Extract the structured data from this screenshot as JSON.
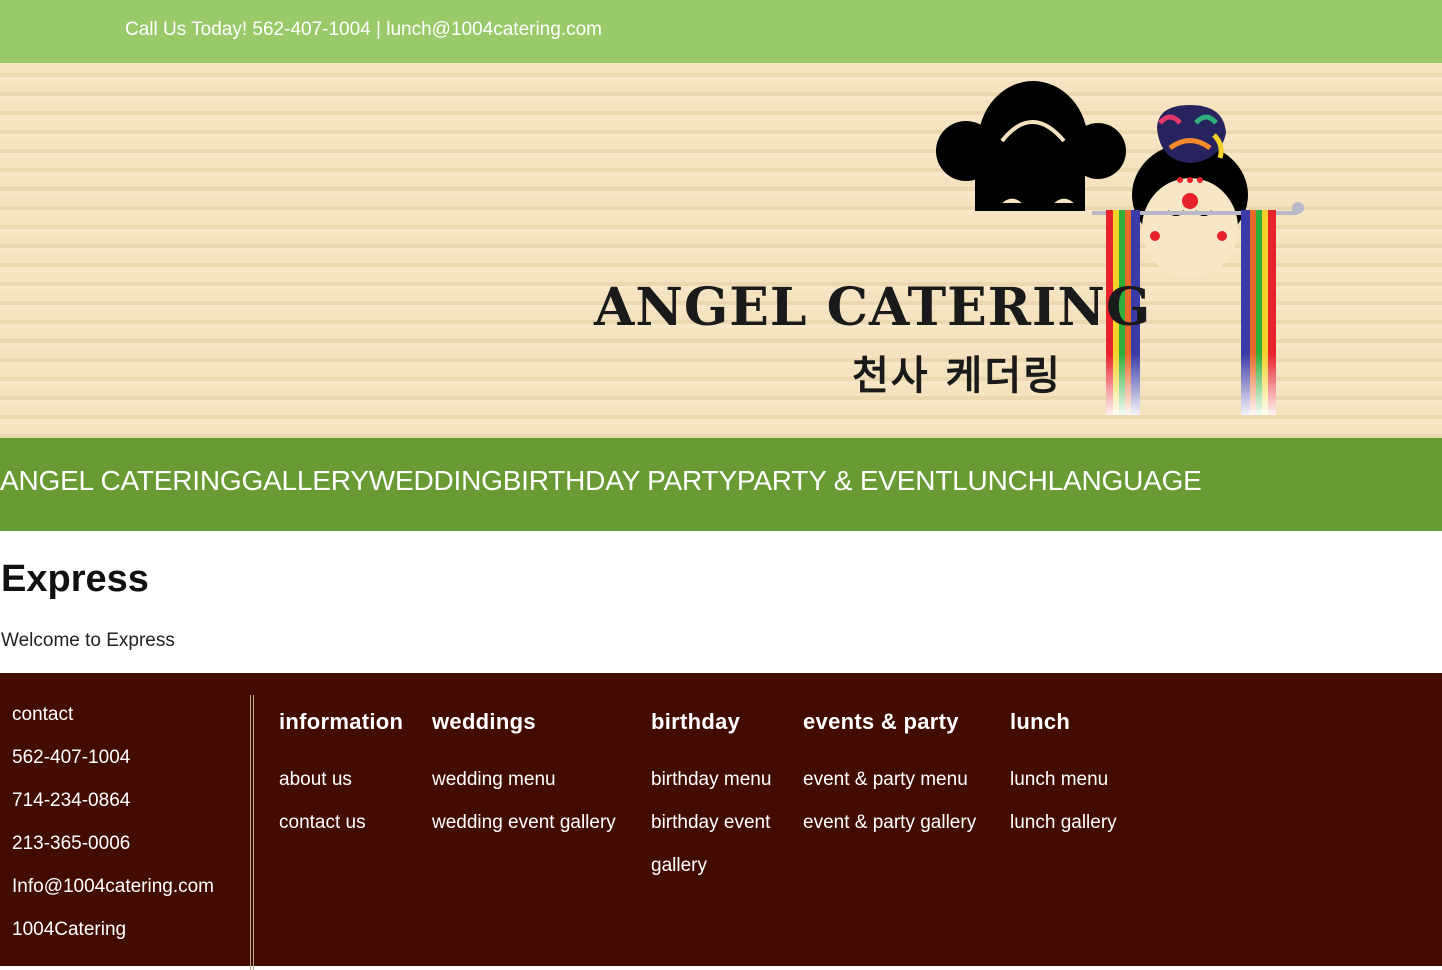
{
  "topbar": {
    "text": "Call Us Today! 562-407-1004 | lunch@1004catering.com"
  },
  "banner": {
    "logo_en": "ANGEL CATERING",
    "logo_ko": "천사 케더링"
  },
  "nav": {
    "items": [
      "ANGEL CATERING",
      "GALLERY",
      "WEDDING",
      "BIRTHDAY PARTY",
      "PARTY & EVENT",
      "LUNCH",
      "LANGUAGE"
    ]
  },
  "main": {
    "title": "Express",
    "text": "Welcome to Express"
  },
  "footer": {
    "contact": {
      "label": "contact",
      "phone1": "562-407-1004",
      "phone2": "714-234-0864",
      "phone3": "213-365-0006",
      "email": "Info@1004catering.com",
      "handle": "1004Catering"
    },
    "columns": [
      {
        "heading": "information",
        "links": [
          "about us",
          "contact us"
        ]
      },
      {
        "heading": "weddings",
        "links": [
          "wedding menu",
          "wedding event gallery"
        ]
      },
      {
        "heading": "birthday",
        "links": [
          "birthday menu",
          "birthday event gallery"
        ]
      },
      {
        "heading": "events & party",
        "links": [
          "event & party menu",
          "event & party gallery"
        ]
      },
      {
        "heading": "lunch",
        "links": [
          "lunch menu",
          "lunch gallery"
        ]
      }
    ]
  },
  "colors": {
    "topbar": "#9ac96a",
    "nav": "#6a9a33",
    "footer": "#420d00",
    "banner": "#f5e3c0"
  }
}
